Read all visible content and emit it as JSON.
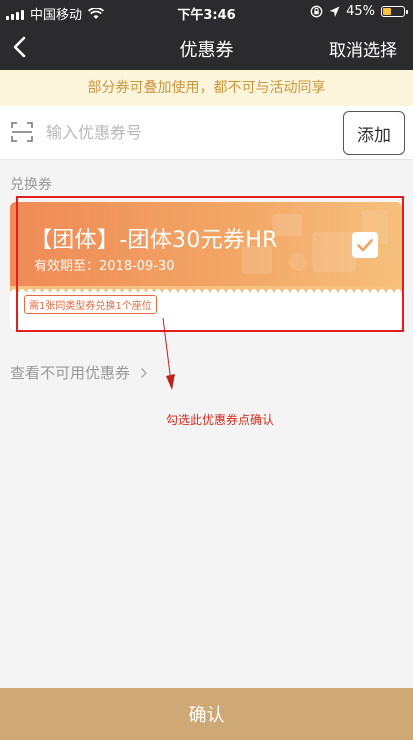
{
  "status_bar": {
    "carrier": "中国移动",
    "time": "下午3:46",
    "battery_percent": "45%",
    "battery_level": 0.45
  },
  "nav": {
    "title": "优惠券",
    "cancel_label": "取消选择"
  },
  "notice": "部分券可叠加使用，都不可与活动同享",
  "code_input": {
    "placeholder": "输入优惠券号",
    "value": ""
  },
  "add_button_label": "添加",
  "section_label": "兑换券",
  "coupon": {
    "name": "【团体】-团体30元券HR",
    "validity": "有效期至：2018-09-30",
    "tag": "需1张同类型券兑换1个座位",
    "selected": true
  },
  "unavailable_link": "查看不可用优惠券",
  "annotation": "勾选此优惠券点确认",
  "confirm_label": "确认",
  "colors": {
    "nav_bg": "#2b2b2d",
    "coupon_start": "#ef8a56",
    "coupon_end": "#f6c07d",
    "confirm_bg": "#cfa975",
    "annotation": "#d52b1e"
  },
  "icons": [
    "signal-icon",
    "wifi-icon",
    "lock-rotation-icon",
    "location-icon",
    "battery-icon",
    "back-icon",
    "scan-icon",
    "checkbox-checked-icon",
    "chevron-right-icon"
  ]
}
